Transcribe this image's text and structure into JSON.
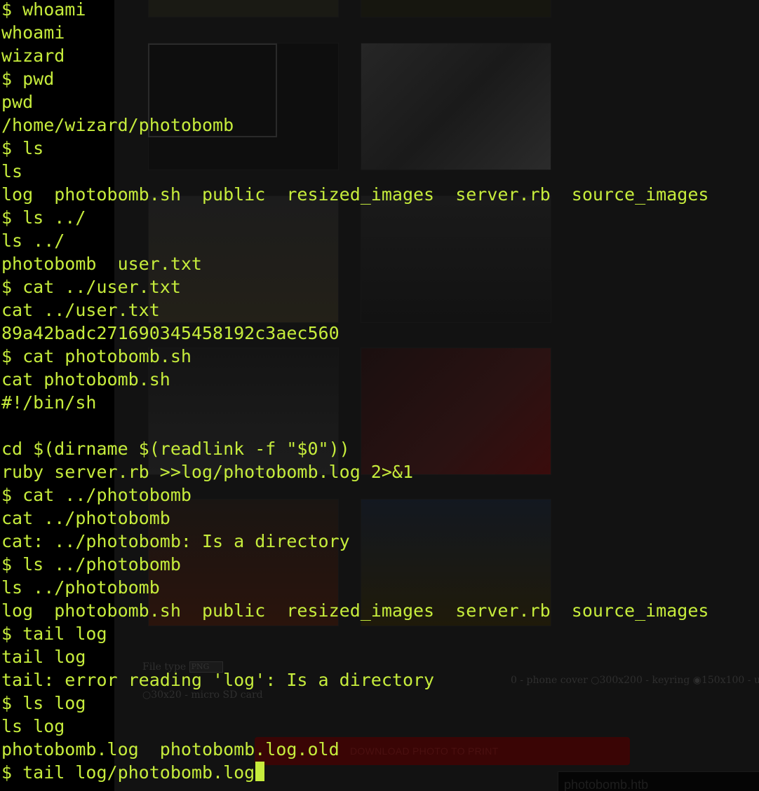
{
  "terminal": {
    "lines": [
      "$ whoami",
      "whoami",
      "wizard",
      "$ pwd",
      "pwd",
      "/home/wizard/photobomb",
      "$ ls",
      "ls",
      "log  photobomb.sh  public  resized_images  server.rb  source_images",
      "$ ls ../",
      "ls ../",
      "photobomb  user.txt",
      "$ cat ../user.txt",
      "cat ../user.txt",
      "89a42badc271690345458192c3aec560",
      "$ cat photobomb.sh",
      "cat photobomb.sh",
      "#!/bin/sh",
      "",
      "cd $(dirname $(readlink -f \"$0\"))",
      "ruby server.rb >>log/photobomb.log 2>&1",
      "$ cat ../photobomb",
      "cat ../photobomb",
      "cat: ../photobomb: Is a directory",
      "$ ls ../photobomb",
      "ls ../photobomb",
      "log  photobomb.sh  public  resized_images  server.rb  source_images",
      "$ tail log",
      "tail log",
      "tail: error reading 'log': Is a directory",
      "$ ls log",
      "ls log",
      "photobomb.log  photobomb.log.old",
      "$ tail log/photobomb.log"
    ],
    "text_color": "#c6ec3c"
  },
  "background_page": {
    "filetype_label": "File type",
    "filetype_value": "PNG",
    "size_options_visible": "0 - phone cover  ○300x200 - keyring  ◉150x100 - usb stick",
    "size_option_last": "○30x20 - micro SD card",
    "download_button_label": "DOWNLOAD PHOTO TO PRINT",
    "host_label": "photobomb.htb",
    "button_color": "#3a0505"
  }
}
